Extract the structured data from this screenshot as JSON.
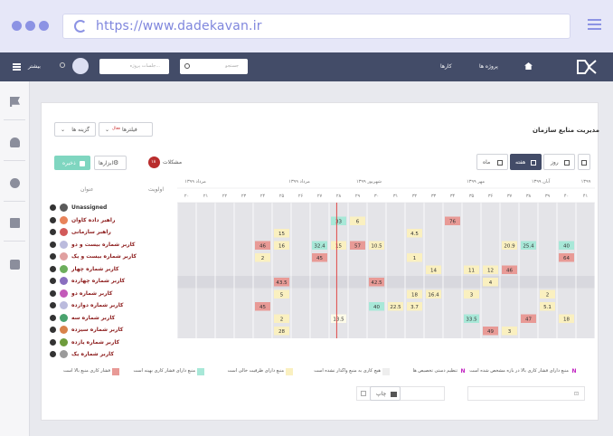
{
  "browser": {
    "url": "https://www.dadekavan.ir"
  },
  "topnav": {
    "menu_label": "بیشتر",
    "search_placeholder": "جستجو",
    "project_search_placeholder": "جلسات پروژه...",
    "projects_label": "پروژه ها",
    "tasks_label": "کارها"
  },
  "page": {
    "title": "مدیریت منابع سازمان",
    "options_label": "گزینه ها",
    "filters_label": "فیلترها",
    "filters_badge": "فعال",
    "save_label": "ذخیره",
    "tools_label": "ابزارها",
    "issues_label": "مشکلات",
    "issues_count": "۱۸",
    "view_day": "روز",
    "view_week": "هفته",
    "view_month": "ماه",
    "col_title": "عنوان",
    "col_priority": "اولویت",
    "print_label": "چاپ"
  },
  "timeline": {
    "months": [
      "۱۳۹۹",
      "آبان ۱۳۹۹",
      "مهر ۱۳۹۹",
      "شهریور ۱۳۹۹",
      "مرداد ۱۳۹۹",
      "مرداد ۱۳۹۹"
    ],
    "weeks": [
      "۴۱",
      "۴۰",
      "۳۹",
      "۳۸",
      "۳۷",
      "۳۶",
      "۳۵",
      "۳۴",
      "۳۳",
      "۳۲",
      "۳۱",
      "۳۰",
      "۲۹",
      "۲۸",
      "۲۷",
      "۲۶",
      "۲۵",
      "۲۴",
      "۲۳",
      "۲۲",
      "۲۱",
      "۲۰"
    ]
  },
  "rows": [
    {
      "name": "Unassigned",
      "avatar": "#5a5a5a",
      "unassigned": true
    },
    {
      "name": "راهبر داده کاوان",
      "avatar": "#e8835a"
    },
    {
      "name": "راهبر سازمانی",
      "avatar": "#d25a5a"
    },
    {
      "name": "کاربر شماره بیست و دو",
      "avatar": "#bbbbdd"
    },
    {
      "name": "کاربر شماره بیست و یک",
      "avatar": "#e0a0a0"
    },
    {
      "name": "کاربر شماره چهار",
      "avatar": "#6cae5c"
    },
    {
      "name": "کاربر شماره چهارده",
      "avatar": "#8a6fbf",
      "highlight": true
    },
    {
      "name": "کاربر شماره دو",
      "avatar": "#c35ab9"
    },
    {
      "name": "کاربر شماره دوازده",
      "avatar": "#bbbbdd"
    },
    {
      "name": "کاربر شماره سه",
      "avatar": "#4aa36e"
    },
    {
      "name": "کاربر شماره سیزده",
      "avatar": "#d8824a"
    },
    {
      "name": "کاربر شماره یازده",
      "avatar": "#6e9c3c"
    },
    {
      "name": "کاربر شماره یک",
      "avatar": "#9a9a9a"
    }
  ],
  "cells": [
    {
      "row": 1,
      "col": 8,
      "v": "76",
      "c": "#e89a96"
    },
    {
      "row": 1,
      "col": 13,
      "v": "6",
      "c": "#faf0c0"
    },
    {
      "row": 1,
      "col": 14,
      "v": "33",
      "c": "#a8e8d8"
    },
    {
      "row": 2,
      "col": 10,
      "v": "4.5",
      "c": "#faf0c0"
    },
    {
      "row": 2,
      "col": 17,
      "v": "15",
      "c": "#faf0c0"
    },
    {
      "row": 3,
      "col": 2,
      "v": "40",
      "c": "#a8e8d8"
    },
    {
      "row": 3,
      "col": 4,
      "v": "25.4",
      "c": "#a8e8d8"
    },
    {
      "row": 3,
      "col": 5,
      "v": "20.9",
      "c": "#faf0c0"
    },
    {
      "row": 3,
      "col": 12,
      "v": "10.5",
      "c": "#faf0c0"
    },
    {
      "row": 3,
      "col": 13,
      "v": "57",
      "c": "#e89a96"
    },
    {
      "row": 3,
      "col": 14,
      "v": "15",
      "c": "#faf0c0"
    },
    {
      "row": 3,
      "col": 15,
      "v": "32.4",
      "c": "#a8e8d8"
    },
    {
      "row": 3,
      "col": 17,
      "v": "16",
      "c": "#faf0c0"
    },
    {
      "row": 3,
      "col": 18,
      "v": "46",
      "c": "#e89a96"
    },
    {
      "row": 4,
      "col": 2,
      "v": "64",
      "c": "#e89a96"
    },
    {
      "row": 4,
      "col": 10,
      "v": "1",
      "c": "#faf0c0"
    },
    {
      "row": 4,
      "col": 15,
      "v": "45",
      "c": "#e89a96"
    },
    {
      "row": 4,
      "col": 18,
      "v": "2",
      "c": "#faf0c0"
    },
    {
      "row": 5,
      "col": 5,
      "v": "46",
      "c": "#e89a96"
    },
    {
      "row": 5,
      "col": 6,
      "v": "12",
      "c": "#faf0c0"
    },
    {
      "row": 5,
      "col": 7,
      "v": "11",
      "c": "#faf0c0"
    },
    {
      "row": 5,
      "col": 9,
      "v": "14",
      "c": "#faf0c0"
    },
    {
      "row": 6,
      "col": 6,
      "v": "4",
      "c": "#faf0c0"
    },
    {
      "row": 6,
      "col": 12,
      "v": "42.5",
      "c": "#e89a96"
    },
    {
      "row": 6,
      "col": 17,
      "v": "43.5",
      "c": "#e89a96"
    },
    {
      "row": 7,
      "col": 3,
      "v": "2",
      "c": "#faf0c0"
    },
    {
      "row": 7,
      "col": 7,
      "v": "3",
      "c": "#faf0c0"
    },
    {
      "row": 7,
      "col": 9,
      "v": "16.4",
      "c": "#faf0c0"
    },
    {
      "row": 7,
      "col": 10,
      "v": "18",
      "c": "#faf0c0"
    },
    {
      "row": 7,
      "col": 17,
      "v": "5",
      "c": "#faf0c0"
    },
    {
      "row": 8,
      "col": 3,
      "v": "5.1",
      "c": "#faf0c0"
    },
    {
      "row": 8,
      "col": 10,
      "v": "3.7",
      "c": "#faf0c0"
    },
    {
      "row": 8,
      "col": 11,
      "v": "22.5",
      "c": "#faf0c0"
    },
    {
      "row": 8,
      "col": 12,
      "v": "40",
      "c": "#a8e8d8"
    },
    {
      "row": 8,
      "col": 18,
      "v": "45",
      "c": "#e89a96"
    },
    {
      "row": 9,
      "col": 2,
      "v": "18",
      "c": "#faf0c0"
    },
    {
      "row": 9,
      "col": 4,
      "v": "47",
      "c": "#e89a96"
    },
    {
      "row": 9,
      "col": 7,
      "v": "33.5",
      "c": "#a8e8d8"
    },
    {
      "row": 9,
      "col": 14,
      "v": "13.5",
      "c": "#fdfbe8"
    },
    {
      "row": 9,
      "col": 17,
      "v": "2",
      "c": "#faf0c0"
    },
    {
      "row": 10,
      "col": 5,
      "v": "3",
      "c": "#faf0c0"
    },
    {
      "row": 10,
      "col": 6,
      "v": "49",
      "c": "#e89a96"
    },
    {
      "row": 10,
      "col": 17,
      "v": "28",
      "c": "#faf0c0"
    },
    {
      "row": 11,
      "col": 2,
      "v": "91",
      "c": "#e89a96"
    },
    {
      "row": 11,
      "col": 6,
      "v": "16",
      "c": "#faf0c0"
    },
    {
      "row": 11,
      "col": 7,
      "v": "32.5",
      "c": "#a8e8d8"
    },
    {
      "row": 11,
      "col": 14,
      "v": "82",
      "c": "#e89a96"
    },
    {
      "row": 11,
      "col": 17,
      "v": "31",
      "c": "#a8e8d8"
    },
    {
      "row": 12,
      "col": 4,
      "v": "5.1",
      "c": "#faf0c0"
    },
    {
      "row": 12,
      "col": 9,
      "v": "47",
      "c": "#e89a96"
    },
    {
      "row": 12,
      "col": 14,
      "v": "88",
      "c": "#e89a96"
    },
    {
      "row": 12,
      "col": 19,
      "v": "4",
      "c": "#faf0c0"
    },
    {
      "row": 12,
      "col": 20,
      "v": "30",
      "c": "#a8e8d8"
    }
  ],
  "legend": [
    {
      "text": "منبع دارای فشار کاری بالا در بازه مشخص شده است",
      "color": "#ffffff",
      "marker": "N"
    },
    {
      "text": "تنظیم دستی تخصیص ها",
      "color": "#ffffff",
      "marker": "N"
    },
    {
      "text": "هیچ کاری به منبع واگذار نشده است",
      "color": "#eeeeee"
    },
    {
      "text": "منبع دارای ظرفیت خالی است",
      "color": "#faf0c0"
    },
    {
      "text": "منبع دارای فشار کاری بهینه است",
      "color": "#a8e8d8"
    },
    {
      "text": "فشار کاری منبع بالا است",
      "color": "#e89a96"
    }
  ],
  "colors": {
    "accent": "#434c68",
    "today_line": "#e04848"
  }
}
